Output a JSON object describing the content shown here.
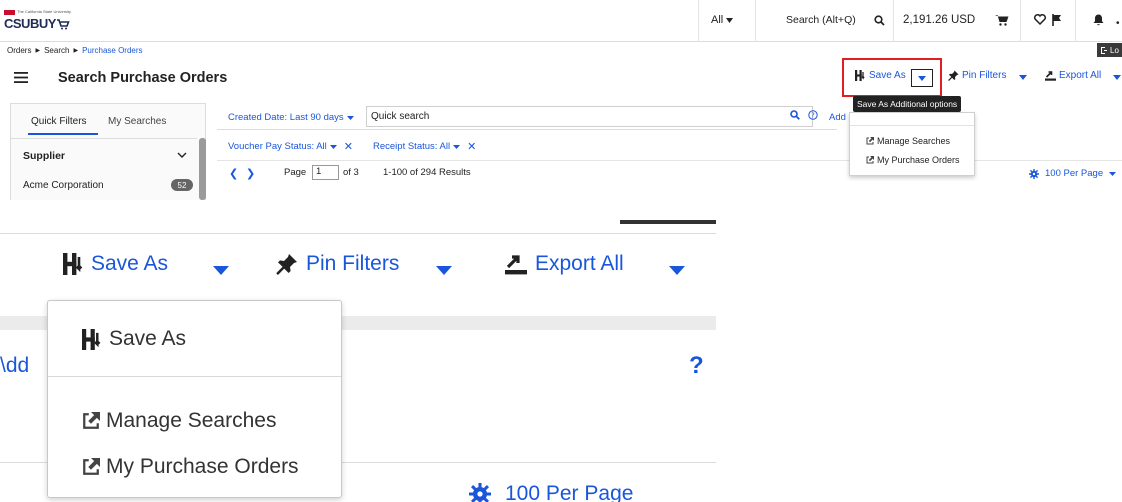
{
  "app": {
    "logo_text": "CSUBUY",
    "logo_tagline": "The California State University"
  },
  "topbar": {
    "scope_label": "All",
    "search_label": "Search (Alt+Q)",
    "amount": "2,191.26 USD",
    "icons": [
      "search-icon",
      "cart-icon",
      "heart-icon",
      "flag-icon",
      "bell-icon"
    ]
  },
  "breadcrumb": {
    "items": [
      "Orders",
      "Search",
      "Purchase Orders"
    ]
  },
  "logout_chip": "Lo",
  "page": {
    "title": "Search Purchase Orders"
  },
  "actions": {
    "save_as": "Save As",
    "pin_filters": "Pin Filters",
    "export_all": "Export All",
    "tooltip": "Save As Additional options"
  },
  "sidebar": {
    "tabs": [
      "Quick Filters",
      "My Searches"
    ],
    "active_tab": "Quick Filters",
    "section": "Supplier",
    "items": [
      {
        "label": "Acme Corporation",
        "count": "52"
      }
    ]
  },
  "filters": {
    "created_date": "Created Date: Last 90 days",
    "quick_search_placeholder": "Quick search",
    "add_label": "Add",
    "voucher": "Voucher Pay Status: All",
    "receipt": "Receipt Status: All"
  },
  "pager": {
    "page_label": "Page",
    "page_value": "1",
    "of_label": "of 3",
    "results": "1-100 of 294 Results",
    "per_page": "100 Per Page"
  },
  "save_as_menu": {
    "items": [
      "Save As",
      "Manage Searches",
      "My Purchase Orders"
    ]
  },
  "zoom": {
    "add_partial": "\\dd",
    "help": "?"
  },
  "colors": {
    "link": "#1a56db",
    "highlight_frame": "#e02020",
    "tooltip_bg": "#222222",
    "brand": "#1d2c55"
  }
}
